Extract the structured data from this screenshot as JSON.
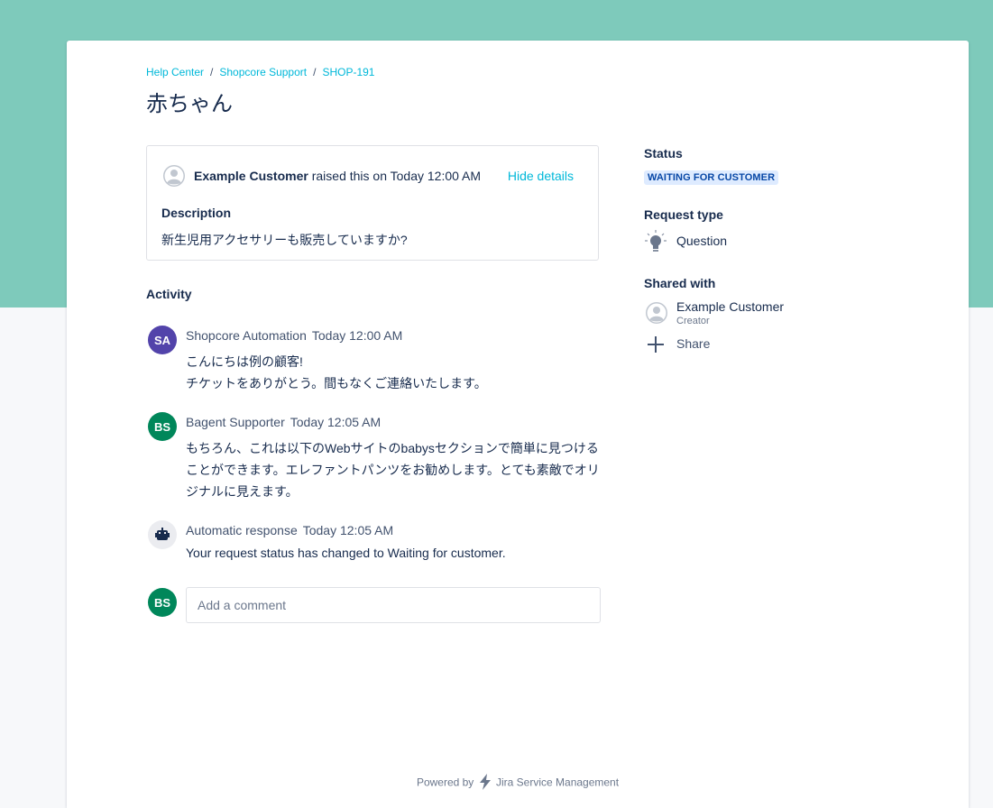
{
  "breadcrumb": [
    "Help Center",
    "Shopcore Support",
    "SHOP-191"
  ],
  "page_title": "赤ちゃん",
  "request": {
    "reporter": "Example Customer",
    "raised_text": "raised this on Today 12:00 AM",
    "hide_details": "Hide details",
    "description_label": "Description",
    "description": "新生児用アクセサリーも販売していますか?"
  },
  "activity": {
    "label": "Activity",
    "items": [
      {
        "initials": "SA",
        "avatar_color": "#5243aa",
        "author": "Shopcore Automation",
        "time": "Today 12:00 AM",
        "lines": [
          "こんにちは例の顧客!",
          "チケットをありがとう。間もなくご連絡いたします。"
        ]
      },
      {
        "initials": "BS",
        "avatar_color": "#00875a",
        "author": "Bagent Supporter",
        "time": "Today 12:05 AM",
        "lines": [
          "もちろん、これは以下のWebサイトのbabysセクションで簡単に見つけることができます。エレファントパンツをお勧めします。とても素敵でオリジナルに見えます。"
        ]
      },
      {
        "initials": "",
        "avatar_icon": "robot-icon",
        "author": "Automatic response",
        "time": "Today 12:05 AM",
        "lines": [
          "Your request status has changed to Waiting for customer."
        ]
      }
    ]
  },
  "comment": {
    "initials": "BS",
    "placeholder": "Add a comment"
  },
  "sidebar": {
    "status_label": "Status",
    "status_value": "WAITING FOR CUSTOMER",
    "request_type_label": "Request type",
    "request_type_value": "Question",
    "request_type_icon": "lightbulb-icon",
    "shared_with_label": "Shared with",
    "shared_name": "Example Customer",
    "shared_role": "Creator",
    "share_label": "Share"
  },
  "footer": {
    "powered_by": "Powered by",
    "product": "Jira Service Management"
  },
  "colors": {
    "banner": "#7ecabb",
    "link": "#00b8d9",
    "lozenge_bg": "#deebff",
    "lozenge_text": "#0747a6"
  }
}
